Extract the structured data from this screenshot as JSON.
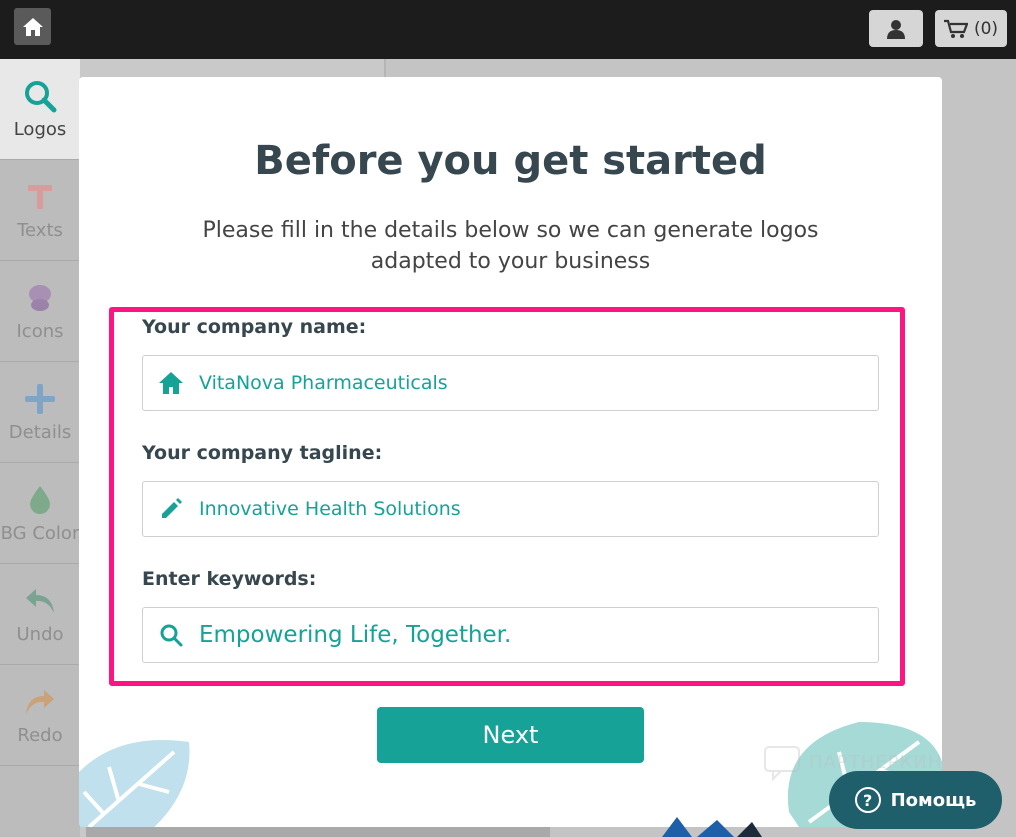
{
  "topbar": {
    "cart_count": "(0)"
  },
  "sidebar": {
    "items": [
      {
        "label": "Logos",
        "icon": "search-icon"
      },
      {
        "label": "Texts",
        "icon": "text-icon"
      },
      {
        "label": "Icons",
        "icon": "icons-icon"
      },
      {
        "label": "Details",
        "icon": "plus-icon"
      },
      {
        "label": "BG Color",
        "icon": "droplet-icon"
      },
      {
        "label": "Undo",
        "icon": "undo-icon"
      },
      {
        "label": "Redo",
        "icon": "redo-icon"
      }
    ]
  },
  "modal": {
    "title": "Before you get started",
    "subtitle_line1": "Please fill in the details below so we can generate logos",
    "subtitle_line2": "adapted to your business",
    "company_name_label": "Your company name:",
    "company_name_value": "VitaNova Pharmaceuticals",
    "tagline_label": "Your company tagline:",
    "tagline_value": "Innovative Health Solutions",
    "keywords_label": "Enter keywords:",
    "keywords_value": "Empowering Life, Together.",
    "next_label": "Next"
  },
  "watermark": "ПАРТНЕРКИН",
  "help": {
    "label": "Помощь",
    "icon_text": "?"
  },
  "colors": {
    "accent": "#16a297",
    "highlight": "#ff1481",
    "title": "#37474f"
  }
}
